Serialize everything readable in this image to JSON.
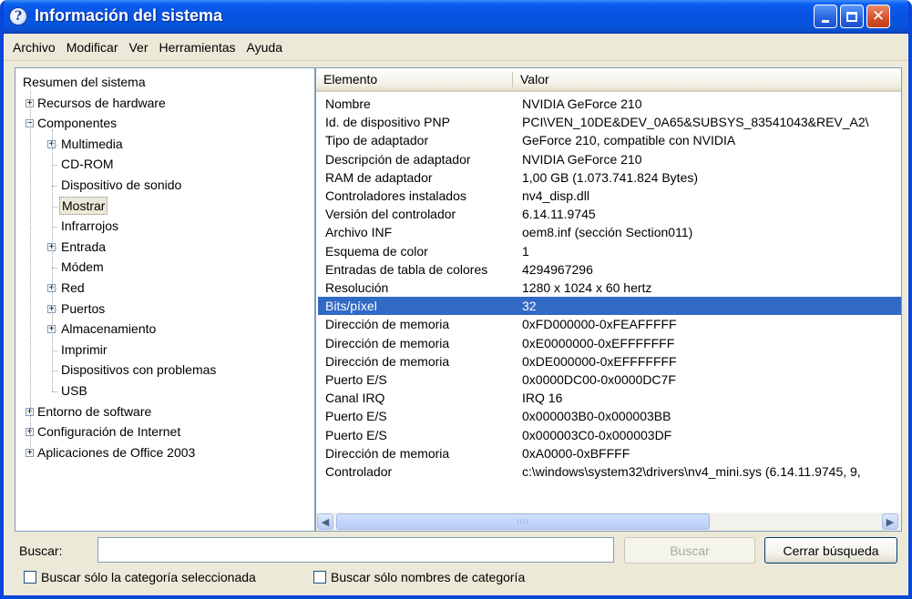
{
  "window": {
    "title": "Información del sistema"
  },
  "menu": [
    "Archivo",
    "Modificar",
    "Ver",
    "Herramientas",
    "Ayuda"
  ],
  "tree": {
    "items": [
      {
        "label": "Resumen del sistema"
      },
      {
        "label": "Recursos de hardware",
        "expander": "+"
      },
      {
        "label": "Componentes",
        "expander": "−"
      },
      {
        "label": "Multimedia",
        "expander": "+"
      },
      {
        "label": "CD-ROM"
      },
      {
        "label": "Dispositivo de sonido"
      },
      {
        "label": "Mostrar",
        "selected": true
      },
      {
        "label": "Infrarrojos"
      },
      {
        "label": "Entrada",
        "expander": "+"
      },
      {
        "label": "Módem"
      },
      {
        "label": "Red",
        "expander": "+"
      },
      {
        "label": "Puertos",
        "expander": "+"
      },
      {
        "label": "Almacenamiento",
        "expander": "+"
      },
      {
        "label": "Imprimir"
      },
      {
        "label": "Dispositivos con problemas"
      },
      {
        "label": "USB"
      },
      {
        "label": "Entorno de software",
        "expander": "+"
      },
      {
        "label": "Configuración de Internet",
        "expander": "+"
      },
      {
        "label": "Aplicaciones de Office 2003",
        "expander": "+"
      }
    ]
  },
  "list": {
    "headers": [
      "Elemento",
      "Valor"
    ],
    "rows": [
      [
        "Nombre",
        "NVIDIA GeForce 210"
      ],
      [
        "Id. de dispositivo PNP",
        "PCI\\VEN_10DE&DEV_0A65&SUBSYS_83541043&REV_A2\\"
      ],
      [
        "Tipo de adaptador",
        "GeForce 210, compatible con NVIDIA"
      ],
      [
        "Descripción de adaptador",
        "NVIDIA GeForce 210"
      ],
      [
        "RAM de adaptador",
        "1,00 GB (1.073.741.824 Bytes)"
      ],
      [
        "Controladores instalados",
        "nv4_disp.dll"
      ],
      [
        "Versión del controlador",
        "6.14.11.9745"
      ],
      [
        "Archivo INF",
        "oem8.inf (sección Section011)"
      ],
      [
        "Esquema de color",
        "1"
      ],
      [
        "Entradas de tabla de colores",
        "4294967296"
      ],
      [
        "Resolución",
        "1280 x 1024 x 60 hertz"
      ],
      [
        "Bits/píxel",
        "32"
      ],
      [
        "Dirección de memoria",
        "0xFD000000-0xFEAFFFFF"
      ],
      [
        "Dirección de memoria",
        "0xE0000000-0xEFFFFFFF"
      ],
      [
        "Dirección de memoria",
        "0xDE000000-0xEFFFFFFF"
      ],
      [
        "Puerto E/S",
        "0x0000DC00-0x0000DC7F"
      ],
      [
        "Canal IRQ",
        "IRQ 16"
      ],
      [
        "Puerto E/S",
        "0x000003B0-0x000003BB"
      ],
      [
        "Puerto E/S",
        "0x000003C0-0x000003DF"
      ],
      [
        "Dirección de memoria",
        "0xA0000-0xBFFFF"
      ],
      [
        "Controlador",
        "c:\\windows\\system32\\drivers\\nv4_mini.sys (6.14.11.9745, 9,"
      ]
    ],
    "selected_row": 11,
    "scroll_grip": "IIII"
  },
  "search": {
    "label": "Buscar:",
    "value": "",
    "find_button": "Buscar",
    "close_button": "Cerrar búsqueda",
    "option1": "Buscar sólo la categoría seleccionada",
    "option2": "Buscar sólo nombres de categoría"
  }
}
